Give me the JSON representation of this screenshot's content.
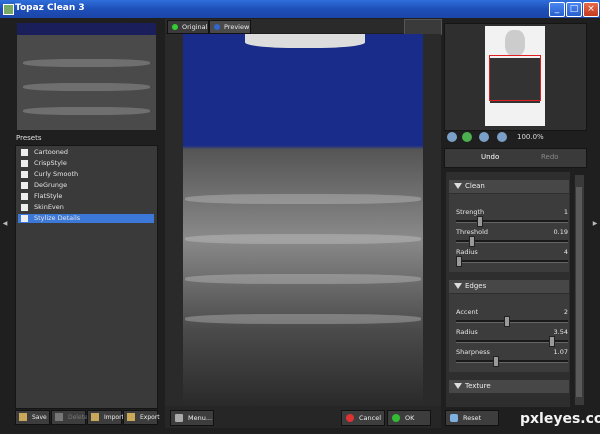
{
  "window": {
    "title": "Topaz Clean 3"
  },
  "presets": {
    "label": "Presets",
    "items": [
      {
        "label": "Cartooned",
        "selected": false
      },
      {
        "label": "CrispStyle",
        "selected": false
      },
      {
        "label": "Curly Smooth",
        "selected": false
      },
      {
        "label": "DeGrunge",
        "selected": false
      },
      {
        "label": "FlatStyle",
        "selected": false
      },
      {
        "label": "SkinEven",
        "selected": false
      },
      {
        "label": "Stylize Details",
        "selected": true
      }
    ],
    "buttons": [
      "Save",
      "Delete",
      "Import",
      "Export"
    ]
  },
  "tabs": {
    "original": "Original",
    "preview": "Preview"
  },
  "center": {
    "menu_label": "Menu...",
    "cancel_label": "Cancel",
    "ok_label": "OK"
  },
  "navigator": {
    "zoom": "100.0%"
  },
  "history": {
    "undo": "Undo",
    "redo": "Redo"
  },
  "settings": {
    "clean": {
      "title": "Clean",
      "params": [
        {
          "label": "Strength",
          "value": "1",
          "pos": 0.2
        },
        {
          "label": "Threshold",
          "value": "0.19",
          "pos": 0.12
        },
        {
          "label": "Radius",
          "value": "4",
          "pos": 0.0
        }
      ]
    },
    "edges": {
      "title": "Edges",
      "params": [
        {
          "label": "Accent",
          "value": "2",
          "pos": 0.45
        },
        {
          "label": "Radius",
          "value": "3.54",
          "pos": 0.88
        },
        {
          "label": "Sharpness",
          "value": "1.07",
          "pos": 0.35
        }
      ]
    },
    "texture": {
      "title": "Texture"
    }
  },
  "reset_label": "Reset",
  "watermark": "pxleyes.com",
  "colors": {
    "accent": "#3b78d8",
    "titlebar": "#245edb"
  }
}
